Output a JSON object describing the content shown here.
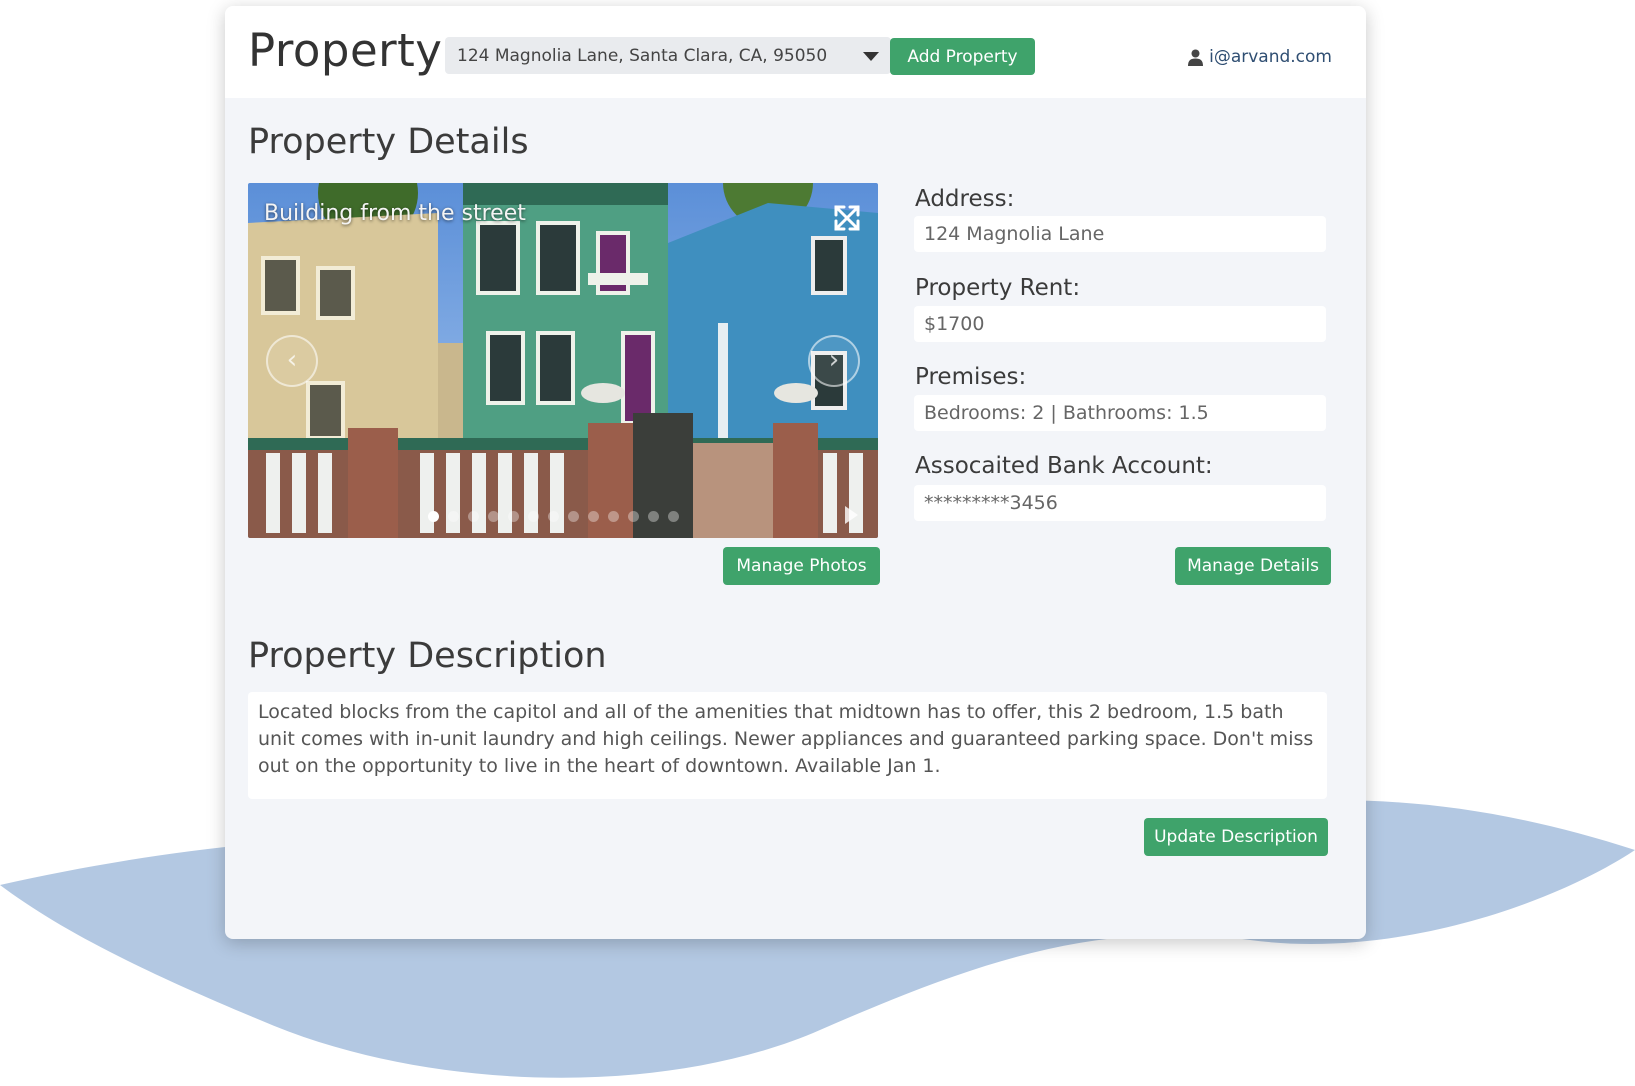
{
  "header": {
    "title": "Property",
    "property_select": "124 Magnolia Lane, Santa Clara, CA, 95050",
    "add_property_label": "Add Property",
    "user_email": "i@arvand.com"
  },
  "details": {
    "heading": "Property Details",
    "carousel": {
      "caption": "Building from the street",
      "slide_count": 13,
      "active_index": 0
    },
    "manage_photos_label": "Manage Photos",
    "fields": {
      "address_label": "Address:",
      "address_value": "124 Magnolia Lane",
      "rent_label": "Property Rent:",
      "rent_value": "$1700",
      "premises_label": "Premises:",
      "premises_value": "Bedrooms: 2 | Bathrooms: 1.5",
      "bank_label": "Assocaited Bank Account:",
      "bank_value": "*********3456"
    },
    "manage_details_label": "Manage Details"
  },
  "description": {
    "heading": "Property Description",
    "text": "Located blocks from the capitol and all of the amenities that midtown has to offer, this 2 bedroom, 1.5 bath unit comes with in-unit laundry and high ceilings. Newer appliances and guaranteed parking space. Don't miss out on the opportunity to live in the heart of downtown. Available Jan 1.",
    "update_label": "Update Description"
  },
  "colors": {
    "accent_green": "#3fa36b",
    "background_wave": "#b3c8e2",
    "card_bg": "#f3f5f9",
    "user_link": "#2f4e72"
  }
}
